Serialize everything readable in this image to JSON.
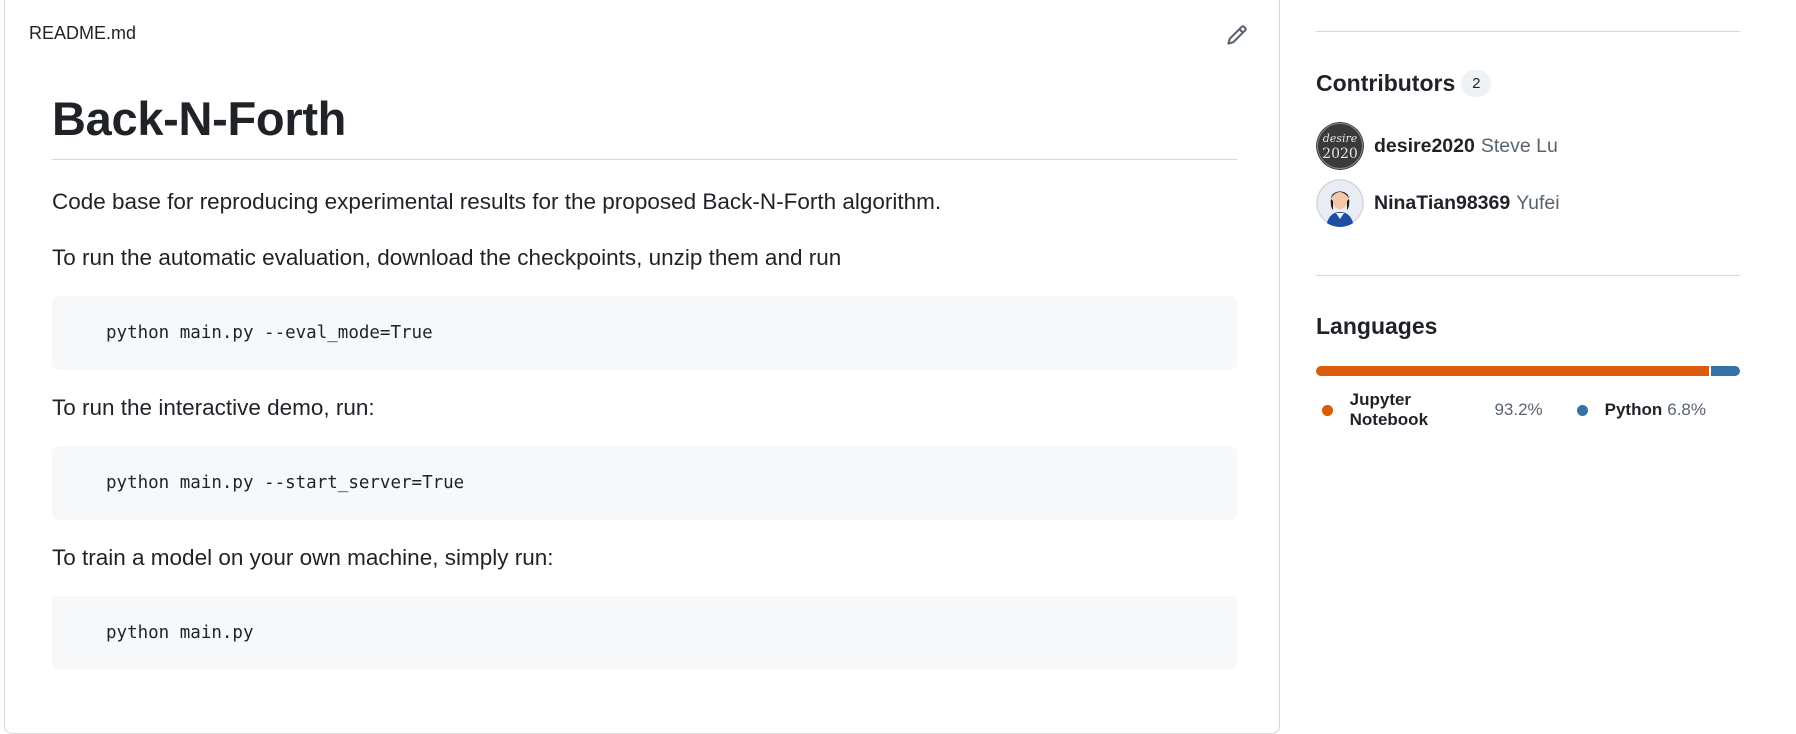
{
  "readme": {
    "filename": "README.md",
    "title": "Back-N-Forth",
    "description": "Code base for reproducing experimental results for the proposed Back-N-Forth algorithm.",
    "eval_intro": "To run the automatic evaluation, download the checkpoints, unzip them and run",
    "eval_command": "python main.py --eval_mode=True",
    "demo_intro": "To run the interactive demo, run:",
    "demo_command": "python main.py --start_server=True",
    "train_intro": "To train a model on your own machine, simply run:",
    "train_command": "python main.py",
    "edit_icon": "pencil-icon"
  },
  "sidebar": {
    "contributors": {
      "title": "Contributors",
      "count": "2",
      "items": [
        {
          "login": "desire2020",
          "name": "Steve Lu",
          "avatar_text": "desire 2020"
        },
        {
          "login": "NinaTian98369",
          "name": "Yufei"
        }
      ]
    },
    "languages": {
      "title": "Languages",
      "items": [
        {
          "name": "Jupyter Notebook",
          "percent": "93.2%",
          "value": 93.2,
          "color": "#DA5B0B"
        },
        {
          "name": "Python",
          "percent": "6.8%",
          "value": 6.8,
          "color": "#3572A5"
        }
      ]
    }
  }
}
